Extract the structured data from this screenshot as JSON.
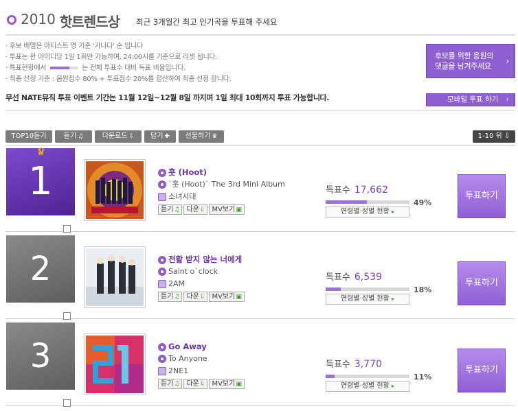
{
  "header": {
    "year": "2010",
    "title": "핫트렌드상",
    "subtitle": "최근 3개월간 최고 인기곡을 투표해 주세요"
  },
  "notes": [
    "· 후보 배열은 아티스트 명 기준 '가나다' 순 입니다",
    "· 투표는 한 아이디당 1일 1회만 가능하며, 24:00시를 기준으로 리셋 됩니다.",
    "· 특표현황에서",
    "· 최종 선정 기준 : 음원점수 80% + 투표점수 20%를 합산하여 최종 선정 합니다."
  ],
  "note3_suffix": "는 전체 투표수 대비 득표 비율입니다.",
  "cta": {
    "line1": "후보를 위한 응원의",
    "line2": "댓글을 남겨주세요",
    "arrow": "›"
  },
  "mobile_vote": {
    "label": "모바일 투표 하기",
    "arrow": "›"
  },
  "event_text": "무선 NATE뮤직 투표 이벤트 기간는 11월 12일~12월 8일 까지며 1일 최대 10회까지 투표 가능합니다.",
  "toolbar": {
    "top10": "TOP10듣기",
    "listen": "듣기",
    "download": "다운로드",
    "save": "담기",
    "gift": "선물하기",
    "range": "1-10 위"
  },
  "labels": {
    "votes": "득표수",
    "detail": "연령별·성별 현황",
    "vote_button": "투표하기",
    "listen": "듣기",
    "download": "다운",
    "mv": "MV보기"
  },
  "entries": [
    {
      "rank": "1",
      "song": "훗 (Hoot)",
      "album": "`훗 (Hoot)` The 3rd Mini Album",
      "artist": "소녀시대",
      "votes": "17,662",
      "percent_label": "49%",
      "percent": 49
    },
    {
      "rank": "2",
      "song": "전활 받지 않는 너에게",
      "album": "Saint o`clock",
      "artist": "2AM",
      "votes": "6,539",
      "percent_label": "18%",
      "percent": 18
    },
    {
      "rank": "3",
      "song": "Go Away",
      "album": "To Anyone",
      "artist": "2NE1",
      "votes": "3,770",
      "percent_label": "11%",
      "percent": 11
    }
  ],
  "colors": {
    "accent": "#8d5cc8",
    "rank_first": "#6a3ab8",
    "rank_other": "#777777"
  }
}
